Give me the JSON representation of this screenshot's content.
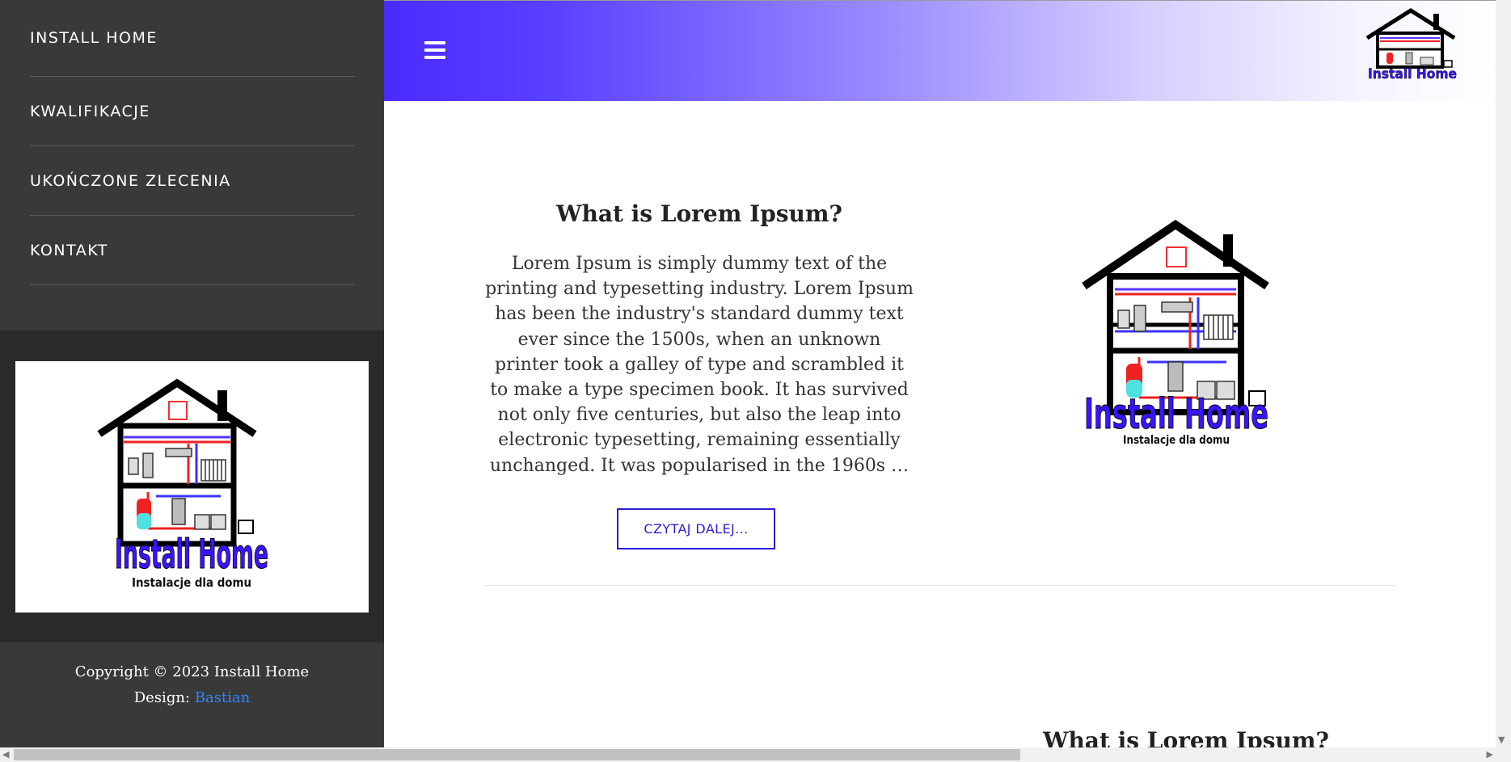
{
  "sidebar": {
    "nav": [
      "INSTALL HOME",
      "KWALIFIKACJE",
      "UKOŃCZONE ZLECENIA",
      "KONTAKT"
    ],
    "copyright": "Copyright © 2023 Install Home",
    "design_label": "Design:",
    "design_link": "Bastian"
  },
  "logo": {
    "brand": "Install Home",
    "tagline": "Instalacje dla domu"
  },
  "main": {
    "section1": {
      "title": "What is Lorem Ipsum?",
      "body": "Lorem Ipsum is simply dummy text of the printing and typesetting industry. Lorem Ipsum has been the industry's standard dummy text ever since the 1500s, when an unknown printer took a galley of type and scrambled it to make a type specimen book. It has survived not only five centuries, but also the leap into electronic typesetting, remaining essentially unchanged. It was popularised in the 1960s …",
      "button": "CZYTAJ DALEJ..."
    },
    "section2": {
      "title": "What is Lorem Ipsum?"
    }
  },
  "colors": {
    "brand_blue": "#2a1dd6",
    "sidebar_bg": "#393939",
    "link_blue": "#2f86ff"
  },
  "icons": [
    "hamburger-menu-icon",
    "house-logo-icon",
    "scroll-arrow-icon"
  ]
}
